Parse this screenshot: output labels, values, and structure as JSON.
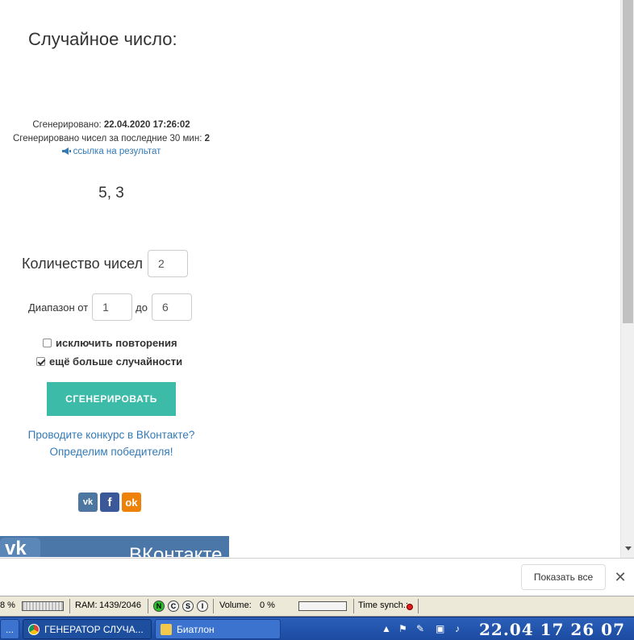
{
  "main": {
    "title": "Случайное число:",
    "generated_label": "Сгенерировано: ",
    "generated_value": "22.04.2020 17:26:02",
    "count_label": "Сгенерировано чисел за последние 30 мин: ",
    "count_value": "2",
    "result_link": "ссылка на результат",
    "result": "5, 3"
  },
  "form": {
    "quantity_label": "Количество чисел",
    "quantity_value": "2",
    "range_from_label": "Диапазон от",
    "range_from_value": "1",
    "range_to_label": "до",
    "range_to_value": "6",
    "exclude_repeats_label": "исключить повторения",
    "exclude_repeats_checked": false,
    "more_random_label": "ещё больше случайности",
    "more_random_checked": true,
    "generate_button": "СГЕНЕРИРОВАТЬ"
  },
  "promo": {
    "line1": "Проводите конкурс в ВКонтакте?",
    "line2": "Определим победителя!"
  },
  "share": {
    "vk": "vk",
    "fb": "f",
    "ok": "ok"
  },
  "banner": {
    "logo": "vk",
    "text": "ВКонтакте"
  },
  "download_bar": {
    "show_all": "Показать все",
    "close": "✕"
  },
  "sysbar": {
    "cpu": "8 %",
    "ram_label": "RAM:",
    "ram_value": "1439/2046",
    "n": "N",
    "c": "C",
    "s": "S",
    "i": "I",
    "volume_label": "Volume:",
    "volume_value": "0 %",
    "time_sync": "Time synch.:"
  },
  "taskbar": {
    "first_button": "...",
    "chrome_window": "ГЕНЕРАТОР СЛУЧА...",
    "folder_window": "Биатлон",
    "clock": "22.04 17 26 07"
  },
  "colors": {
    "accent": "#3cbca8",
    "link": "#337ab7",
    "vk": "#4d76a1",
    "facebook": "#3b5998",
    "ok": "#ee8208"
  }
}
